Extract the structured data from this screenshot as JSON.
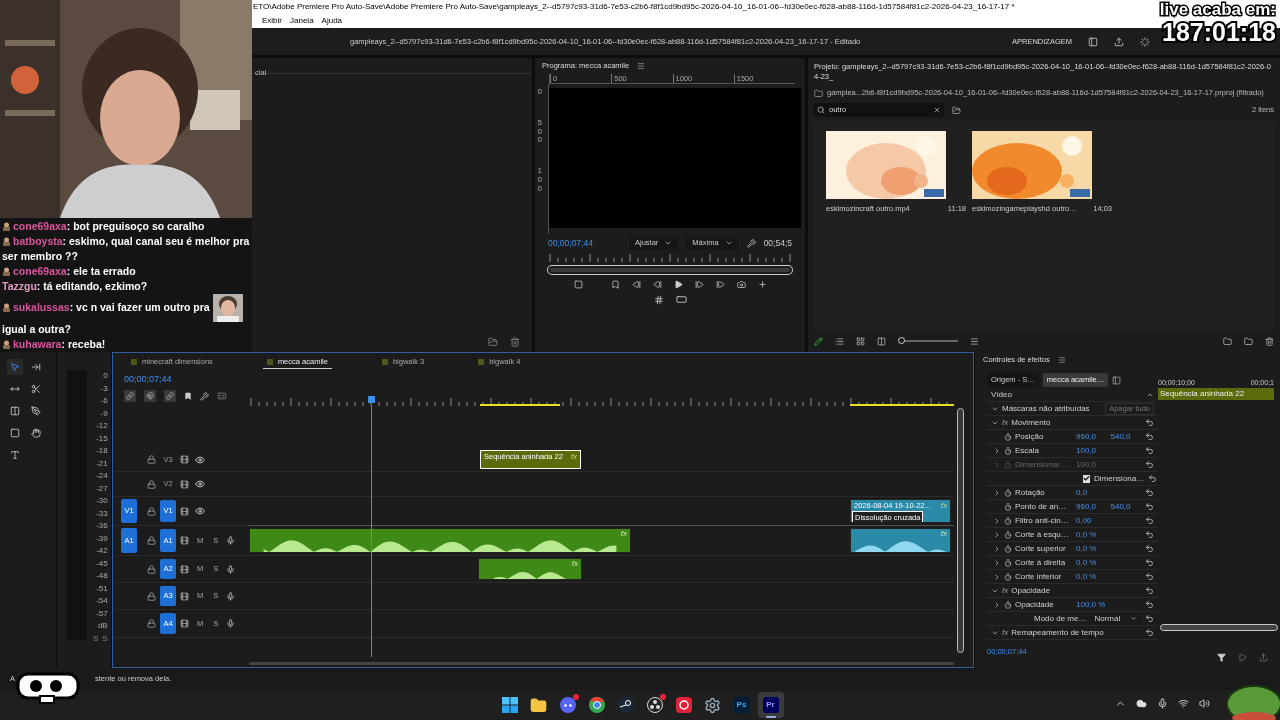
{
  "overlay": {
    "timer_label": "live acaba em:",
    "timer": "187:01:18"
  },
  "chat": [
    {
      "user": "cone69axa",
      "sep": ":",
      "color": "#d9559f",
      "badge": true,
      "parts": [
        {
          "kind": "text",
          "text": "bot preguisoço so caralho"
        }
      ]
    },
    {
      "user": "batboysta",
      "sep": ":",
      "color": "#d9559f",
      "badge": true,
      "parts": [
        {
          "kind": "text",
          "text": "eskimo, qual canal seu é melhor pra ser membro ??"
        }
      ]
    },
    {
      "user": "cone69axa",
      "sep": ":",
      "color": "#d9559f",
      "badge": true,
      "parts": [
        {
          "kind": "text",
          "text": "ele ta errado"
        }
      ]
    },
    {
      "user": "Tazzgu",
      "sep": ":",
      "color": "#e49ac4",
      "badge": false,
      "parts": [
        {
          "kind": "text",
          "text": "tá editando, ezkimo?"
        }
      ]
    },
    {
      "user": "sukalussas",
      "sep": ":",
      "color": "#d9559f",
      "badge": true,
      "parts": [
        {
          "kind": "text",
          "text": "vc n vai fazer um outro pra"
        },
        {
          "kind": "emote"
        },
        {
          "kind": "text",
          "text": "igual a outra?"
        }
      ]
    },
    {
      "user": "kuhawara",
      "sep": ":",
      "color": "#d9559f",
      "badge": true,
      "parts": [
        {
          "kind": "text",
          "text": "receba!"
        }
      ]
    }
  ],
  "title_bar": {
    "path": "ETO\\Adobe Premiere Pro Auto-Save\\Adobe Premiere Pro Auto-Save\\gampleays_2--d5797c93-31d6-7e53-c2b6-f8f1cd9bd95c-2026-04-10_16-01-06--fd30e0ec-f628-ab88-116d-1d57584f81c2-2026-04-23_16-17-17 *",
    "menu": [
      "Exibir",
      "Janela",
      "Ajuda"
    ]
  },
  "header": {
    "title": "gampleays_2--d5797c93-31d6-7e53-c2b6-f8f1cd9bd95c-2026-04-10_16-01-06--fd30e0ec-f628-ab88-116d-1d57584f81c2-2026-04-23_16-17-17 - Editado",
    "workspace": "APRENDIZAGEM"
  },
  "source_panel": {
    "tab": "cial"
  },
  "program": {
    "title": "Programa: mecca acamile",
    "ruler": [
      "0",
      "500",
      "1000",
      "1500"
    ],
    "vruler": [
      "0",
      "500",
      "100"
    ],
    "timecode": "00;00;07;44",
    "fit": "Ajustar",
    "quality": "Máxima",
    "duration": "00;54;5"
  },
  "project": {
    "title": "Projeto: gampleays_2--d5797c93-31d6-7e53-c2b6-f8f1cd9bd95c-2026-04-10_16-01-06--fd30e0ec-f628-ab88-116d-1d57584f81c2-2026-04-23_",
    "bin": "gamplea...2b6-f8f1cd9bd95c-2026-04-10_16-01-06--fd30e0ec-f628-ab88-116d-1d57584f81c2-2026-04-23_16-17-17.prproj (filtrado)",
    "search": "outro",
    "count": "2 itens",
    "zoom": {
      "level": 0.05
    },
    "items": [
      {
        "name": "eskimozincraft outro.mp4",
        "duration": "11:18"
      },
      {
        "name": "eskimozingameplayshd outro…",
        "duration": "14;03"
      }
    ]
  },
  "tools": [
    {
      "kind": "select",
      "selected": true
    },
    {
      "kind": "track",
      "selected": false
    },
    {
      "kind": "ripple",
      "selected": false
    },
    {
      "kind": "razor",
      "selected": false
    },
    {
      "kind": "slip",
      "selected": false
    },
    {
      "kind": "pen",
      "selected": false
    },
    {
      "kind": "rect",
      "selected": false
    },
    {
      "kind": "hand",
      "selected": false
    },
    {
      "kind": "type",
      "selected": false
    }
  ],
  "meter": {
    "scale": [
      "0",
      "-3",
      "-6",
      "-9",
      "-12",
      "-15",
      "-18",
      "-21",
      "-24",
      "-27",
      "-30",
      "-33",
      "-36",
      "-39",
      "-42",
      "-45",
      "-48",
      "-51",
      "-54",
      "-57",
      "dB"
    ],
    "solo": [
      "S",
      "S"
    ]
  },
  "timeline": {
    "tabs": [
      {
        "label": "minecraft dimensions",
        "selected": false
      },
      {
        "label": "mecca acamile",
        "selected": true
      },
      {
        "label": "bigwalk 3",
        "selected": false
      },
      {
        "label": "bigwalk 4",
        "selected": false
      }
    ],
    "timecode": "00;00;07;44",
    "tracks": [
      {
        "kind": "video",
        "label": "V3",
        "targeted": false
      },
      {
        "kind": "video",
        "label": "V2",
        "targeted": false
      },
      {
        "kind": "video",
        "label": "V1",
        "targeted": true,
        "source": "V1"
      },
      {
        "kind": "audio",
        "label": "A1",
        "targeted": true,
        "source": "A1",
        "mute": "M",
        "solo": "S"
      },
      {
        "kind": "audio",
        "label": "A2",
        "targeted": true,
        "mute": "M",
        "solo": "S"
      },
      {
        "kind": "audio",
        "label": "A3",
        "targeted": true,
        "mute": "M",
        "solo": "S"
      },
      {
        "kind": "audio",
        "label": "A4",
        "targeted": true,
        "mute": "M",
        "solo": "S"
      }
    ],
    "clips": [
      {
        "kind": "video",
        "label": "Sequência aninhada 22",
        "fx": "fx",
        "color": "#5b6b0c",
        "selected": true
      },
      {
        "kind": "video",
        "label": "2026-08-04 19-10-22...",
        "transition": "Dissolução cruzada",
        "fx": "fx",
        "color": "#2a8aa8",
        "selected": false
      },
      {
        "kind": "audio",
        "fx": "fx",
        "color": "#3f8a16",
        "selected": false
      },
      {
        "kind": "audio",
        "fx": "fx",
        "color": "#2a8aa8",
        "selected": false
      },
      {
        "kind": "audio",
        "fx": "fx",
        "color": "#3f8a16",
        "selected": false
      }
    ]
  },
  "effects": {
    "title": "Controles de efeitos",
    "tabs": [
      {
        "label": "Origem - S…",
        "selected": false
      },
      {
        "label": "mecca acamile…",
        "selected": true
      }
    ],
    "ruler": [
      "00;00;10;00",
      "00;00;1"
    ],
    "clip": "Sequência aninhada 22",
    "group": "Vídeo",
    "rows": [
      {
        "kind": "section",
        "label": "Máscaras não atribuídas",
        "expanded": true,
        "action": "Apagar tudo"
      },
      {
        "kind": "section",
        "label": "Movimento",
        "expanded": true,
        "fx": "fx"
      },
      {
        "kind": "property",
        "label": "Posição",
        "values": [
          "960,0",
          "540,0"
        ],
        "disabled": false
      },
      {
        "kind": "group",
        "label": "Escala",
        "values": [
          "100,0"
        ],
        "disabled": false
      },
      {
        "kind": "group",
        "label": "Dimensionar …",
        "values": [
          "100,0"
        ],
        "disabled": true
      },
      {
        "kind": "checkbox",
        "label": "Dimensiona…",
        "checked": true
      },
      {
        "kind": "group",
        "label": "Rotação",
        "values": [
          "0,0"
        ],
        "disabled": false
      },
      {
        "kind": "property",
        "label": "Ponto de an…",
        "values": [
          "960,0",
          "540,0"
        ],
        "disabled": false
      },
      {
        "kind": "group",
        "label": "Filtro anti-cin…",
        "values": [
          "0,00"
        ],
        "disabled": false
      },
      {
        "kind": "group",
        "label": "Corte à esqu…",
        "values": [
          "0,0 %"
        ],
        "disabled": false
      },
      {
        "kind": "group",
        "label": "Corte superior",
        "values": [
          "0,0 %"
        ],
        "disabled": false
      },
      {
        "kind": "group",
        "label": "Corte à direita",
        "values": [
          "0,0 %"
        ],
        "disabled": false
      },
      {
        "kind": "group",
        "label": "Corte inferior",
        "values": [
          "0,0 %"
        ],
        "disabled": false
      },
      {
        "kind": "section",
        "label": "Opacidade",
        "expanded": true,
        "fx": "fx"
      },
      {
        "kind": "group",
        "label": "Opacidade",
        "values": [
          "100,0 %"
        ],
        "disabled": false
      },
      {
        "kind": "select",
        "label": "Modo de me…",
        "value": "Normal"
      },
      {
        "kind": "section",
        "label": "Remapeamento de tempo",
        "expanded": true,
        "fx": "fx"
      }
    ],
    "timecode": "00;00;07;44"
  },
  "status_bar": {
    "prefix": "A",
    "text": "stente ou remova dela."
  },
  "taskbar": {
    "apps": [
      {
        "kind": "windows",
        "selected": false,
        "notification": false
      },
      {
        "kind": "folder",
        "selected": false,
        "notification": false
      },
      {
        "kind": "discord",
        "selected": false,
        "notification": true
      },
      {
        "kind": "chrome",
        "selected": false,
        "notification": false
      },
      {
        "kind": "steam",
        "selected": false,
        "notification": false
      },
      {
        "kind": "obs",
        "selected": false,
        "notification": true
      },
      {
        "kind": "record",
        "selected": false,
        "notification": false
      },
      {
        "kind": "settings",
        "selected": false,
        "notification": false
      },
      {
        "kind": "ps",
        "label": "Ps",
        "selected": false,
        "notification": false
      },
      {
        "kind": "pr",
        "label": "Pr",
        "selected": true,
        "notification": false
      }
    ]
  }
}
